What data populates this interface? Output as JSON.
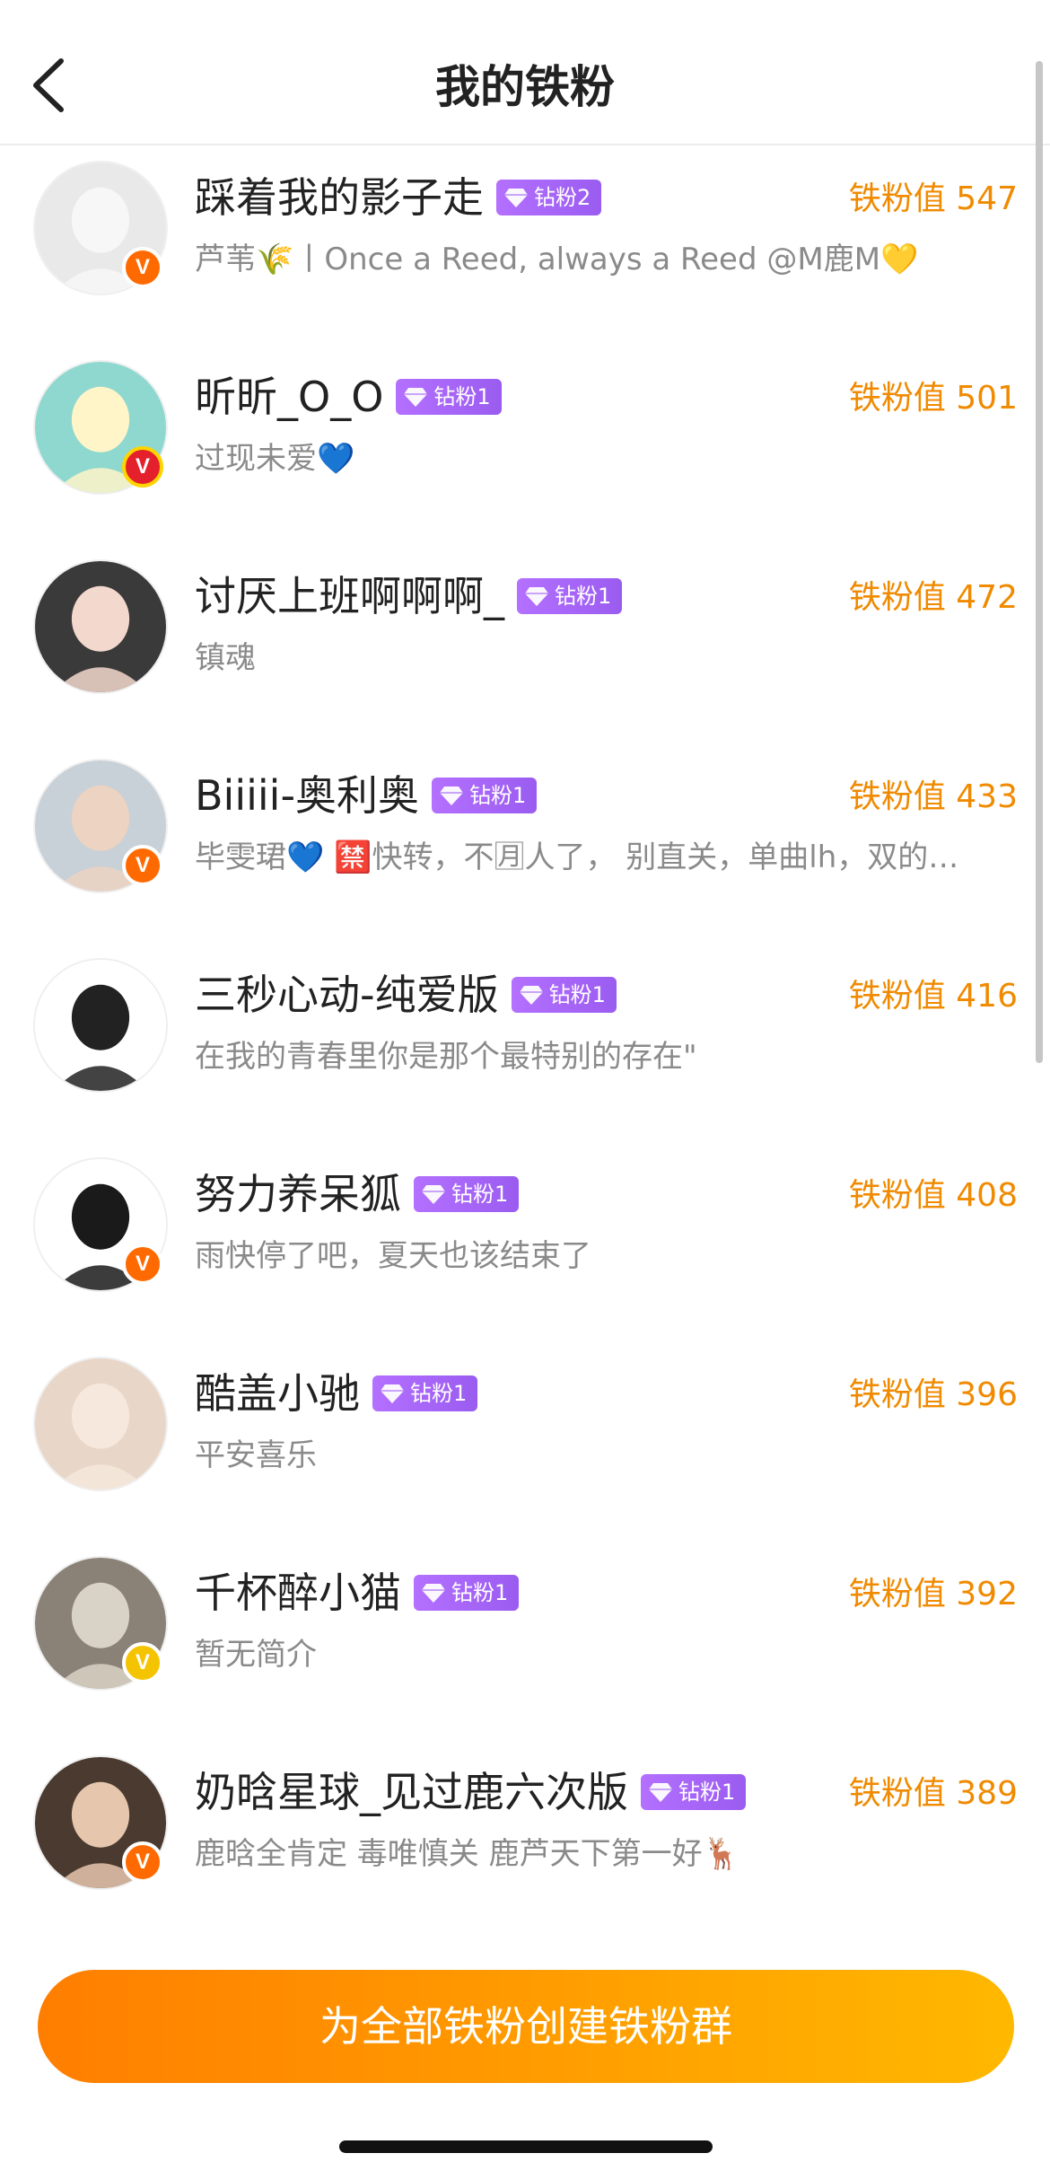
{
  "header": {
    "title": "我的铁粉"
  },
  "colors": {
    "accent_orange": "#f08a00",
    "tag_purple": "#a865f5",
    "button_start": "#ff7e00",
    "button_end": "#ffb800"
  },
  "fans": [
    {
      "name": "踩着我的影子走",
      "tag": "钻粉2",
      "score": "铁粉值 547",
      "bio": "芦苇🌾丨Once a Reed, always a Reed @M鹿M💛",
      "badge": "orange",
      "avatar_bg": "#e9e9e9",
      "avatar_fg": "#f7f7f7"
    },
    {
      "name": "昕昕_O_O",
      "tag": "钻粉1",
      "score": "铁粉值 501",
      "bio": "过现未爱💙",
      "badge": "red",
      "avatar_bg": "#8fd8d0",
      "avatar_fg": "#fff5c8"
    },
    {
      "name": "讨厌上班啊啊啊_",
      "tag": "钻粉1",
      "score": "铁粉值 472",
      "bio": "镇魂",
      "badge": "",
      "avatar_bg": "#3a3a3a",
      "avatar_fg": "#f3d8cd"
    },
    {
      "name": "Biiiii-奥利奥",
      "tag": "钻粉1",
      "score": "铁粉值 433",
      "bio": "毕雯珺💙 🈲快转，不🈷人了， 别直关，单曲lh，双的…",
      "badge": "orange",
      "avatar_bg": "#c8d0d8",
      "avatar_fg": "#ecd3c2"
    },
    {
      "name": "三秒心动-纯爱版",
      "tag": "钻粉1",
      "score": "铁粉值 416",
      "bio": "在我的青春里你是那个最特别的存在\"",
      "badge": "",
      "avatar_bg": "#ffffff",
      "avatar_fg": "#222222"
    },
    {
      "name": "努力养呆狐",
      "tag": "钻粉1",
      "score": "铁粉值 408",
      "bio": "雨快停了吧，夏天也该结束了",
      "badge": "orange",
      "avatar_bg": "#ffffff",
      "avatar_fg": "#1a1a1a"
    },
    {
      "name": "酷盖小驰",
      "tag": "钻粉1",
      "score": "铁粉值 396",
      "bio": "平安喜乐",
      "badge": "",
      "avatar_bg": "#e8d6c8",
      "avatar_fg": "#f6e8dc"
    },
    {
      "name": "千杯醉小猫",
      "tag": "钻粉1",
      "score": "铁粉值 392",
      "bio": "暂无简介",
      "badge": "yellow",
      "avatar_bg": "#8a8276",
      "avatar_fg": "#d9d2c6"
    },
    {
      "name": "奶晗星球_见过鹿六次版",
      "tag": "钻粉1",
      "score": "铁粉值 389",
      "bio": "鹿晗全肯定 毒唯慎关 鹿芦天下第一好🦌",
      "badge": "orange",
      "avatar_bg": "#4a3a30",
      "avatar_fg": "#e6c6ad"
    }
  ],
  "badge_letter": "V",
  "footer": {
    "create_button_label": "为全部铁粉创建铁粉群"
  }
}
